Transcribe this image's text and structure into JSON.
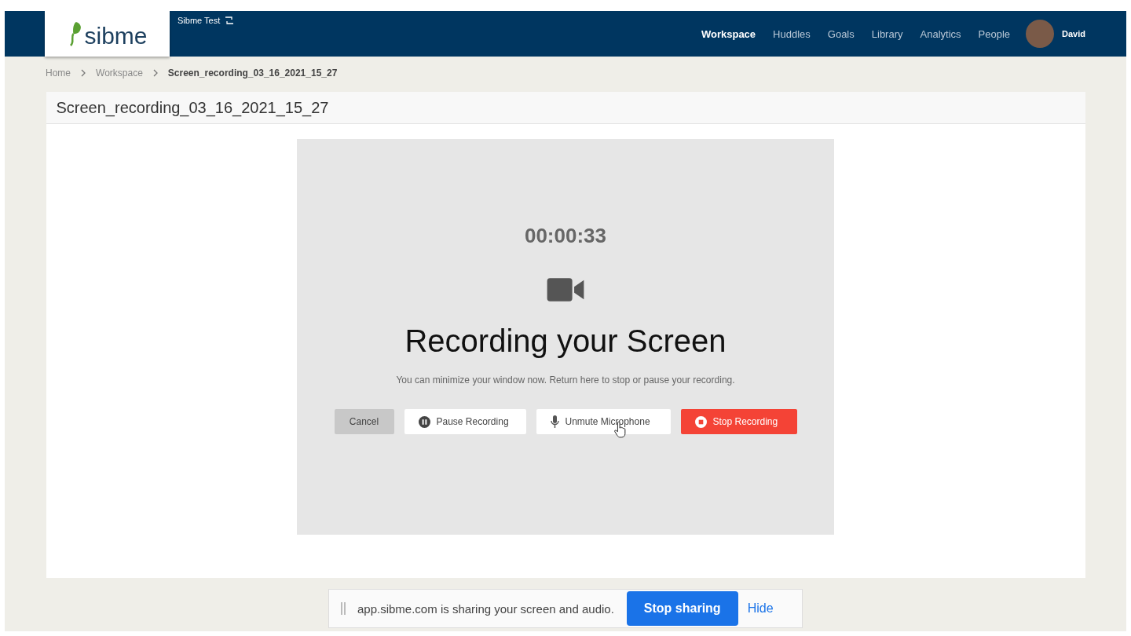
{
  "header": {
    "logo": "sibme",
    "account": "Sibme Test",
    "nav": [
      {
        "label": "Workspace",
        "selected": true
      },
      {
        "label": "Huddles",
        "selected": false
      },
      {
        "label": "Goals",
        "selected": false
      },
      {
        "label": "Library",
        "selected": false
      },
      {
        "label": "Analytics",
        "selected": false
      },
      {
        "label": "People",
        "selected": false
      }
    ],
    "user": "David"
  },
  "breadcrumb": [
    {
      "label": "Home",
      "current": false
    },
    {
      "label": "Workspace",
      "current": false
    },
    {
      "label": "Screen_recording_03_16_2021_15_27",
      "current": true
    }
  ],
  "page_title": "Screen_recording_03_16_2021_15_27",
  "recorder": {
    "timer": "00:00:33",
    "heading": "Recording your Screen",
    "message": "You can minimize your window now. Return here to stop or pause your recording.",
    "buttons": [
      {
        "kind": "cancel",
        "label": "Cancel"
      },
      {
        "kind": "pause",
        "label": "Pause Recording"
      },
      {
        "kind": "mic",
        "label": "Unmute Microphone"
      },
      {
        "kind": "stop",
        "label": "Stop Recording"
      }
    ]
  },
  "share_bar": {
    "message": "app.sibme.com is sharing your screen and audio.",
    "stop": "Stop sharing",
    "hide": "Hide"
  }
}
